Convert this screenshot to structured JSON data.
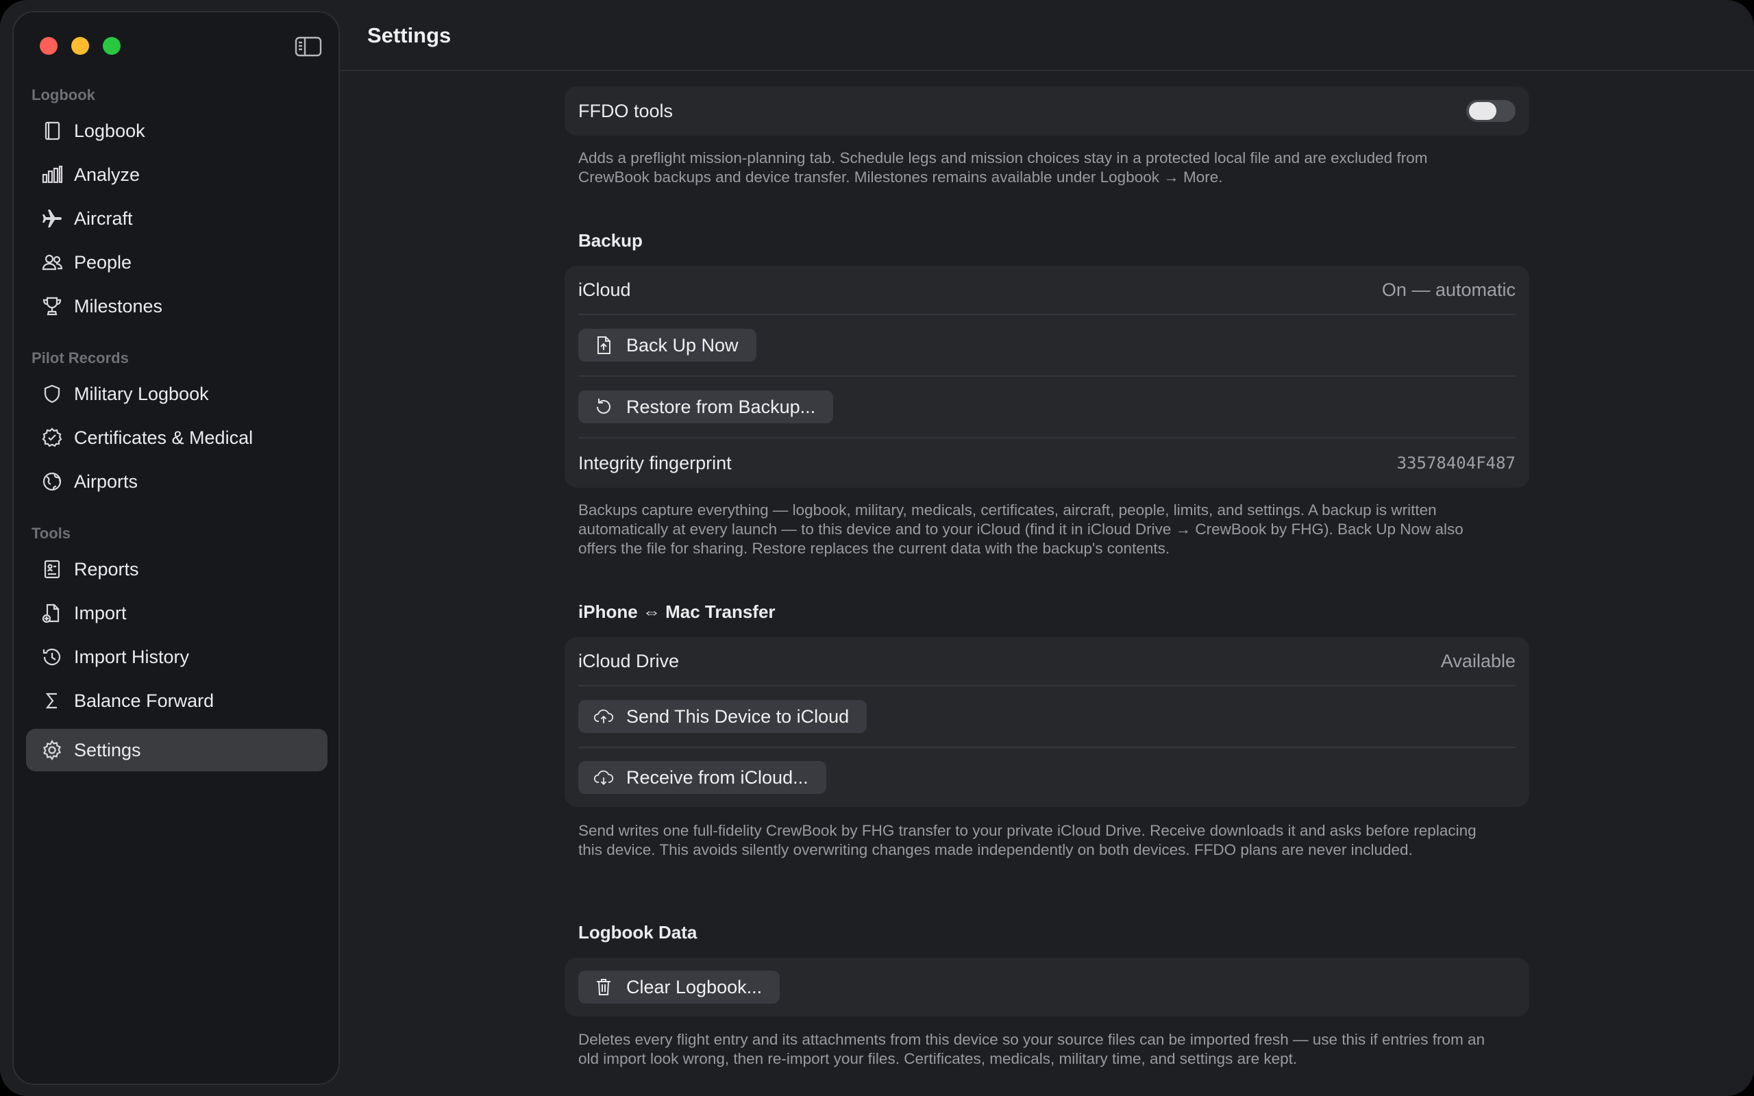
{
  "window": {
    "title": "Settings"
  },
  "colors": {
    "accent_red": "#fe5f57",
    "accent_yellow": "#febc2e",
    "accent_green": "#28c840",
    "selected_bg": "#3b3c40"
  },
  "sidebar": {
    "sections": [
      {
        "label": "Logbook",
        "items": [
          {
            "label": "Logbook",
            "icon": "book-icon"
          },
          {
            "label": "Analyze",
            "icon": "bar-chart-icon"
          },
          {
            "label": "Aircraft",
            "icon": "airplane-icon"
          },
          {
            "label": "People",
            "icon": "people-icon"
          },
          {
            "label": "Milestones",
            "icon": "trophy-icon"
          }
        ]
      },
      {
        "label": "Pilot Records",
        "items": [
          {
            "label": "Military Logbook",
            "icon": "shield-icon"
          },
          {
            "label": "Certificates & Medical",
            "icon": "seal-check-icon"
          },
          {
            "label": "Airports",
            "icon": "globe-icon"
          }
        ]
      },
      {
        "label": "Tools",
        "items": [
          {
            "label": "Reports",
            "icon": "report-icon"
          },
          {
            "label": "Import",
            "icon": "import-doc-icon"
          },
          {
            "label": "Import History",
            "icon": "history-icon"
          },
          {
            "label": "Balance Forward",
            "icon": "sigma-icon"
          }
        ]
      }
    ],
    "settings": {
      "label": "Settings",
      "icon": "gear-icon",
      "selected": true
    }
  },
  "ffdo": {
    "label": "FFDO tools",
    "enabled": false,
    "footnote": "Adds a preflight mission-planning tab. Schedule legs and mission choices stay in a protected local file and are excluded from CrewBook backups and device transfer. Milestones remains available under Logbook → More."
  },
  "backup": {
    "header": "Backup",
    "icloud_label": "iCloud",
    "icloud_value": "On — automatic",
    "back_up_now": "Back Up Now",
    "restore": "Restore from Backup...",
    "fingerprint_label": "Integrity fingerprint",
    "fingerprint_value": "33578404F487",
    "footnote": "Backups capture everything — logbook, military, medicals, certificates, aircraft, people, limits, and settings. A backup is written automatically at every launch — to this device and to your iCloud (find it in iCloud Drive → CrewBook by FHG). Back Up Now also offers the file for sharing. Restore replaces the current data with the backup's contents."
  },
  "transfer": {
    "header": "iPhone ⇔ Mac Transfer",
    "drive_label": "iCloud Drive",
    "drive_value": "Available",
    "send": "Send This Device to iCloud",
    "receive": "Receive from iCloud...",
    "footnote": "Send writes one full-fidelity CrewBook by FHG transfer to your private iCloud Drive. Receive downloads it and asks before replacing this device. This avoids silently overwriting changes made independently on both devices. FFDO plans are never included."
  },
  "logbook_data": {
    "header": "Logbook Data",
    "clear": "Clear Logbook...",
    "footnote": "Deletes every flight entry and its attachments from this device so your source files can be imported fresh — use this if entries from an old import look wrong, then re-import your files. Certificates, medicals, military time, and settings are kept."
  }
}
